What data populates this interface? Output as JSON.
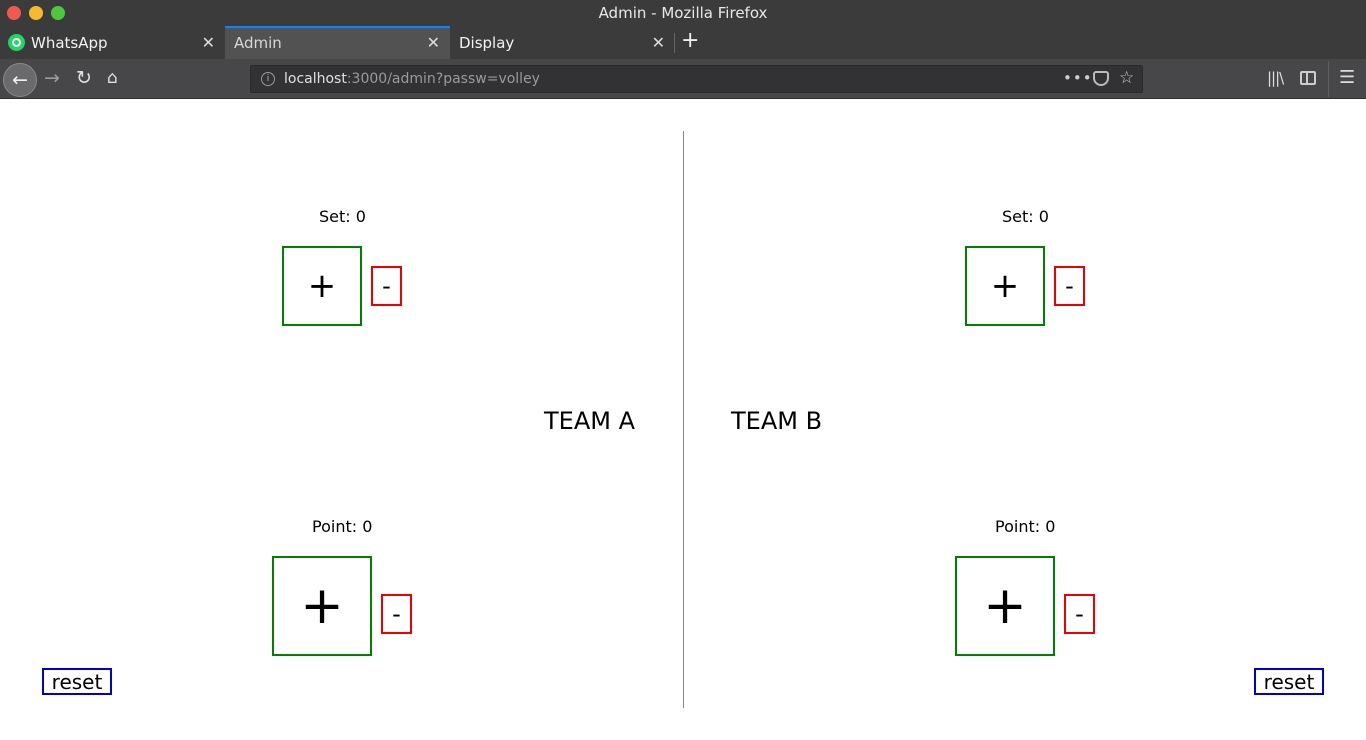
{
  "window": {
    "title": "Admin - Mozilla Firefox"
  },
  "tabs": [
    {
      "label": "WhatsApp",
      "icon": "whatsapp-icon"
    },
    {
      "label": "Admin",
      "active": true
    },
    {
      "label": "Display"
    }
  ],
  "toolbar": {
    "url_host": "localhost",
    "url_rest": ":3000/admin?passw=volley"
  },
  "team_a": {
    "name": "TEAM A",
    "set_label": "Set: 0",
    "point_label": "Point: 0",
    "plus": "+",
    "minus": "-",
    "reset": "reset"
  },
  "team_b": {
    "name": "TEAM B",
    "set_label": "Set: 0",
    "point_label": "Point: 0",
    "plus": "+",
    "minus": "-",
    "reset": "reset"
  },
  "colors": {
    "plus_border": "#008000",
    "minus_border": "#e00000",
    "reset_border": "#0000d0",
    "active_tab_accent": "#0a84ff"
  }
}
